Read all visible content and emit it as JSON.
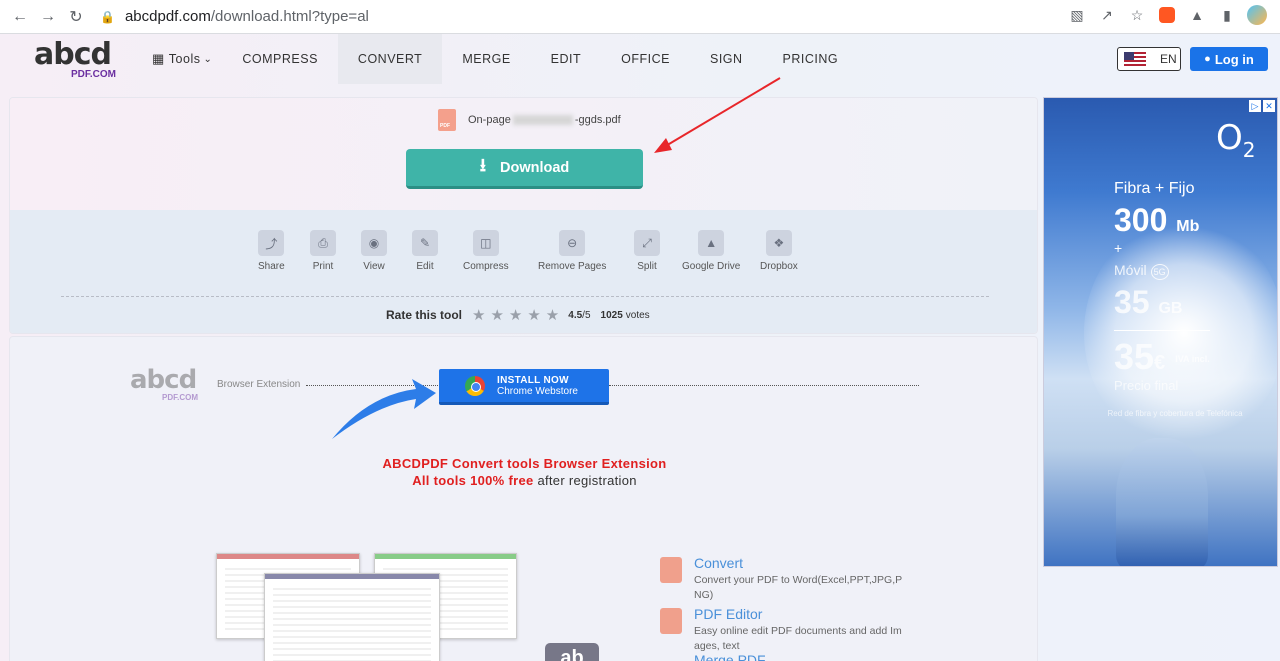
{
  "browser": {
    "url_host": "abcdpdf.com",
    "url_path": "/download.html?type=al"
  },
  "header": {
    "logo_text": "abcd",
    "logo_sub": "PDF.COM",
    "tools_label": "Tools",
    "nav": [
      "COMPRESS",
      "CONVERT",
      "MERGE",
      "EDIT",
      "OFFICE",
      "SIGN",
      "PRICING"
    ],
    "active_nav": "CONVERT",
    "lang": "EN",
    "login": "Log in"
  },
  "file": {
    "prefix": "On-page",
    "suffix": "-ggds.pdf"
  },
  "download_label": "Download",
  "tools": [
    {
      "label": "Share",
      "icon": "share-icon"
    },
    {
      "label": "Print",
      "icon": "print-icon"
    },
    {
      "label": "View",
      "icon": "view-icon"
    },
    {
      "label": "Edit",
      "icon": "edit-icon"
    },
    {
      "label": "Compress",
      "icon": "compress-icon"
    },
    {
      "label": "Remove Pages",
      "icon": "remove-icon"
    },
    {
      "label": "Split",
      "icon": "split-icon"
    },
    {
      "label": "Google Drive",
      "icon": "google-drive-icon"
    },
    {
      "label": "Dropbox",
      "icon": "dropbox-icon"
    }
  ],
  "rating": {
    "label": "Rate this tool",
    "score": "4.5",
    "max": "/5",
    "votes": "1025",
    "votes_label": "votes"
  },
  "extension": {
    "label": "Browser Extension",
    "install_line1": "INSTALL NOW",
    "install_line2": "Chrome Webstore",
    "promo_title": "ABCDPDF Convert tools Browser Extension",
    "promo_red": "All tools 100% free",
    "promo_rest": "after registration"
  },
  "features": [
    {
      "title": "Convert",
      "desc": "Convert your PDF to Word(Excel,PPT,JPG,P NG)"
    },
    {
      "title": "PDF Editor",
      "desc": "Easy online edit PDF documents and add Im ages, text"
    },
    {
      "title": "Merge PDF",
      "desc": ""
    }
  ],
  "ad": {
    "brand": "O",
    "brand_sub": "2",
    "line1": "Fibra + Fijo",
    "speed": "300",
    "speed_unit": "Mb",
    "plus": "+",
    "movil": "Móvil",
    "movil_badge": "5G",
    "data": "35",
    "data_unit": "GB",
    "price": "35",
    "price_unit": "€",
    "iva": "IVA incl.",
    "price_label": "Precio final",
    "footnote": "Red de fibra y cobertura de Telefónica"
  },
  "colors": {
    "download_btn": "#3fb4a8",
    "login_btn": "#1a73e8",
    "install_btn": "#1e73e8",
    "promo_red": "#e02020"
  }
}
